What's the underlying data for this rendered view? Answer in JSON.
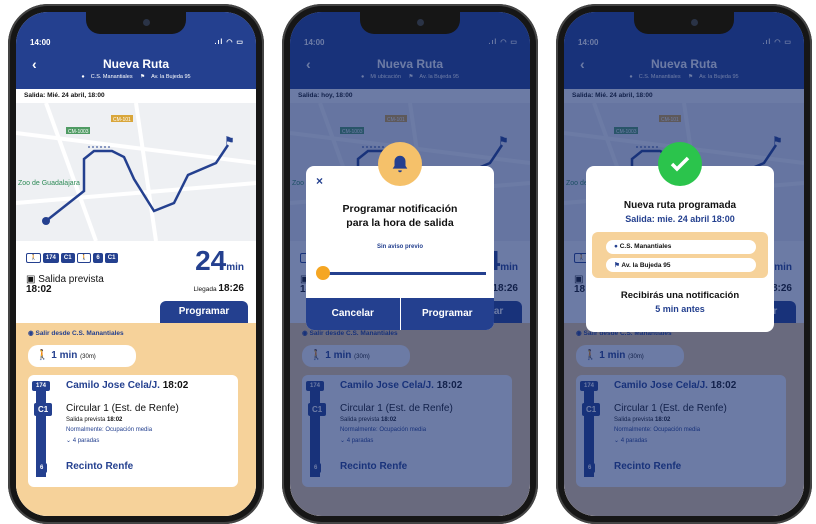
{
  "status": {
    "time": "14:00"
  },
  "screens": [
    {
      "title": "Nueva Ruta",
      "origin": "C.S. Manantiales",
      "destination": "Av. la Bujeda 95",
      "salida": "Salida: Mié. 24 abril, 18:00"
    },
    {
      "title": "Nueva Ruta",
      "origin": "Mi ubicación",
      "destination": "Av. la Bujeda 95",
      "salida": "Salida: hoy, 18:00"
    },
    {
      "title": "Nueva Ruta",
      "origin": "C.S. Manantiales",
      "destination": "Av. la Bujeda 95",
      "salida": "Salida: Mié. 24 abril, 18:00"
    }
  ],
  "map": {
    "roads": [
      "CM-101",
      "CM-1003",
      "CM-1101"
    ],
    "poi": "Zoo de Guadalajara"
  },
  "route": {
    "chips": [
      "174",
      "C1",
      "6",
      "C1"
    ],
    "duration": "24",
    "duration_unit": "min",
    "salida_label": "Salida prevista",
    "salida_time": "18:02",
    "llegada_label": "Llegada",
    "llegada_time": "18:26",
    "programar": "Programar",
    "salir": "Salir desde C.S. Manantiales",
    "walk": "1 min",
    "walk_dist": "(30m)",
    "bus_tag": "174",
    "bus_stop": "Camilo Jose Cela/J.",
    "bus_time": "18:02",
    "line_tag": "C1",
    "line_name": "Circular 1 (Est. de Renfe)",
    "line_salida": "Salida prevista",
    "line_salida_time": "18:02",
    "occupancy": "Normalmente: Ocupación media",
    "stops": "4 paradas",
    "end_tag": "6",
    "end_stop": "Recinto Renfe"
  },
  "modal": {
    "title1": "Programar notificación",
    "title2": "para la hora de salida",
    "subtitle": "Sin aviso previo",
    "cancel": "Cancelar",
    "confirm": "Programar",
    "close": "×"
  },
  "confirm": {
    "title": "Nueva ruta programada",
    "subtitle": "Salida: mie. 24 abril 18:00",
    "from": "C.S. Manantiales",
    "to": "Av. la Bujeda 95",
    "notify": "Recibirás una notificación",
    "notify_time": "5 min antes"
  },
  "colors": {
    "primary": "#24408f",
    "accent": "#f6d29a",
    "success": "#2bc44c",
    "bell": "#f5c16a"
  }
}
